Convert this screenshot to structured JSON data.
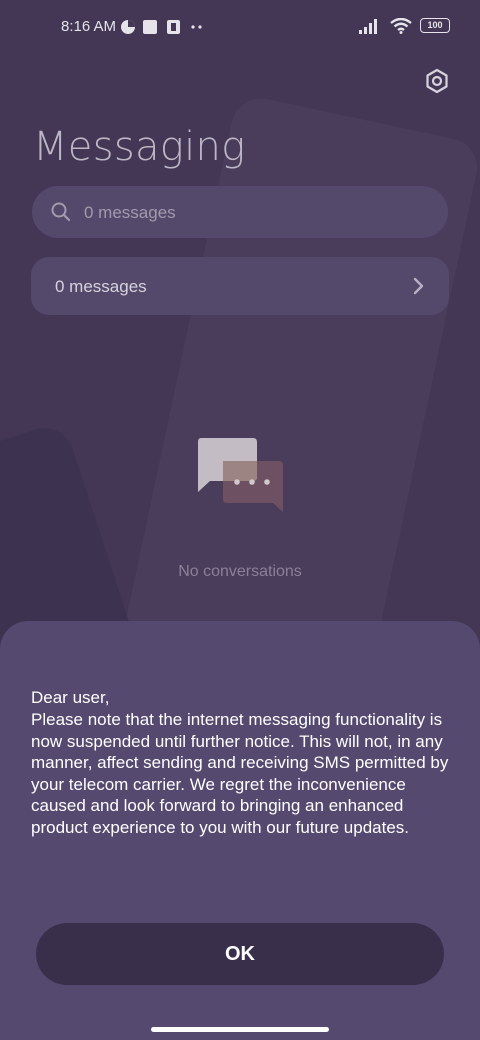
{
  "status_bar": {
    "time": "8:16 AM",
    "battery": "100"
  },
  "header": {
    "title": "Messaging",
    "settings_icon": "gear-icon"
  },
  "search": {
    "placeholder": "0 messages"
  },
  "messages_card": {
    "label": "0 messages"
  },
  "empty_state": {
    "label": "No conversations"
  },
  "dialog": {
    "greeting": "Dear user,",
    "body": "Please note that the internet messaging functionality is now suspended until further notice. This will not, in any manner, affect sending and receiving SMS permitted by your telecom carrier. We regret the inconvenience caused and look forward to bringing an enhanced product experience to you with our future updates.",
    "ok_label": "OK"
  },
  "colors": {
    "background": "#433755",
    "sheet": "#564970",
    "button": "#3a2f4b"
  }
}
